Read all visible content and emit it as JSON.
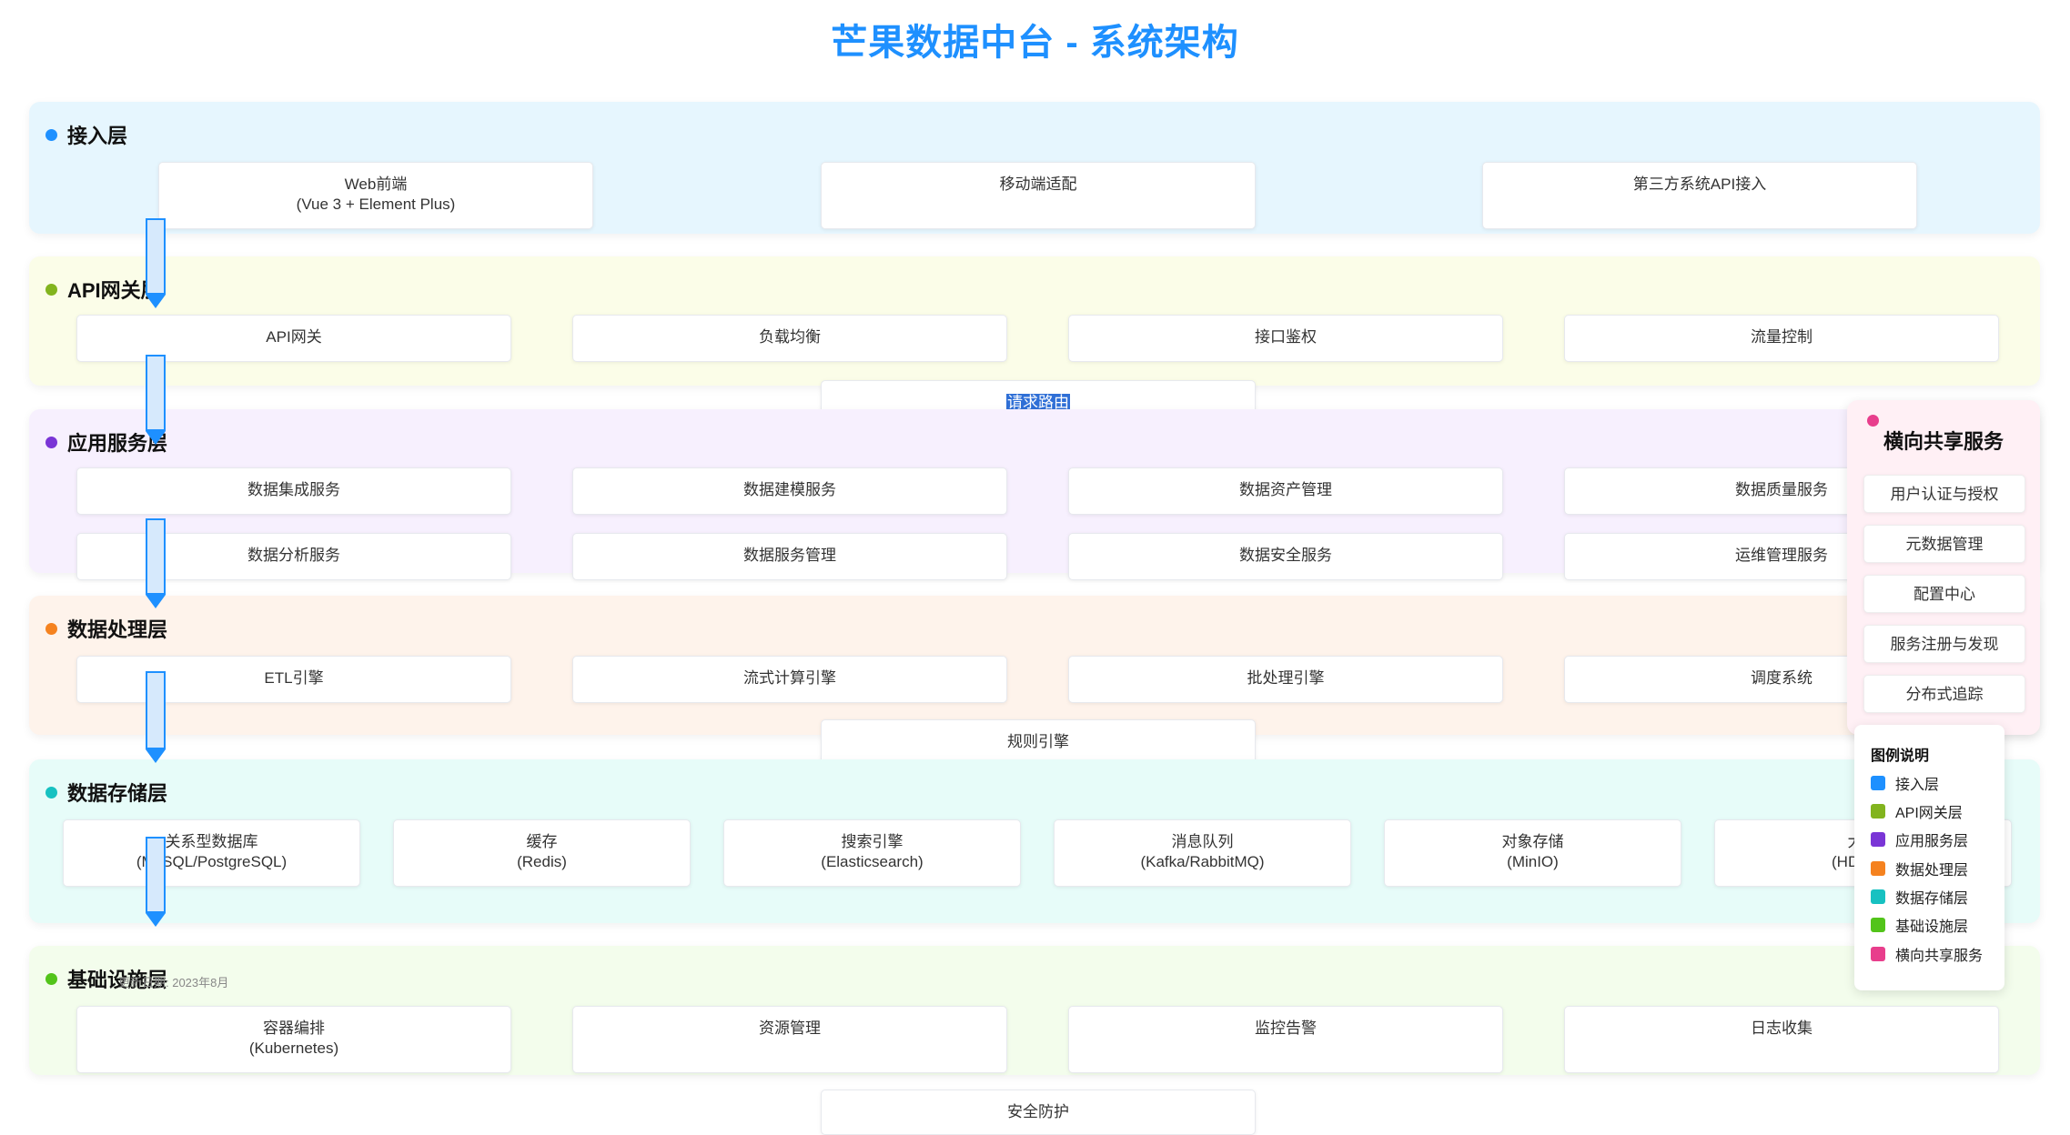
{
  "title": "芒果数据中台 - 系统架构",
  "colors": {
    "access": "#1e90ff",
    "gateway": "#82b41e",
    "app": "#7a35d6",
    "processing": "#f5821f",
    "storage": "#17c1c1",
    "infra": "#52c41a",
    "shared": "#e83e8c"
  },
  "layers": {
    "access": {
      "name": "接入层",
      "cards": [
        "Web前端",
        "(Vue 3 + Element Plus)",
        "移动端适配",
        "第三方系统API接入"
      ]
    },
    "gateway": {
      "name": "API网关层",
      "cards": [
        "API网关",
        "负载均衡",
        "接口鉴权",
        "流量控制",
        "请求路由"
      ]
    },
    "app": {
      "name": "应用服务层",
      "cards": [
        "数据集成服务",
        "数据建模服务",
        "数据资产管理",
        "数据质量服务",
        "数据分析服务",
        "数据服务管理",
        "数据安全服务",
        "运维管理服务"
      ]
    },
    "processing": {
      "name": "数据处理层",
      "cards": [
        "ETL引擎",
        "流式计算引擎",
        "批处理引擎",
        "调度系统",
        "规则引擎"
      ]
    },
    "storage": {
      "name": "数据存储层",
      "cards": [
        {
          "label": "关系型数据库",
          "sub": "(MySQL/PostgreSQL)"
        },
        {
          "label": "缓存",
          "sub": "(Redis)"
        },
        {
          "label": "搜索引擎",
          "sub": "(Elasticsearch)"
        },
        {
          "label": "消息队列",
          "sub": "(Kafka/RabbitMQ)"
        },
        {
          "label": "对象存储",
          "sub": "(MinIO)"
        },
        {
          "label": "大数",
          "sub": "(HDFS/H"
        }
      ]
    },
    "infra": {
      "name": "基础设施层",
      "cards": [
        {
          "label": "容器编排",
          "sub": "(Kubernetes)"
        },
        {
          "label": "资源管理",
          "sub": ""
        },
        {
          "label": "监控告警",
          "sub": ""
        },
        {
          "label": "日志收集",
          "sub": ""
        },
        {
          "label": "安全防护",
          "sub": ""
        }
      ]
    }
  },
  "shared": {
    "title": "横向共享服务",
    "items": [
      "用户认证与授权",
      "元数据管理",
      "配置中心",
      "服务注册与发现",
      "分布式追踪"
    ]
  },
  "legend": {
    "title": "图例说明",
    "items": [
      "接入层",
      "API网关层",
      "应用服务层",
      "数据处理层",
      "数据存储层",
      "基础设施层",
      "横向共享服务"
    ]
  },
  "footnote": "更新日期: 2023年8月"
}
